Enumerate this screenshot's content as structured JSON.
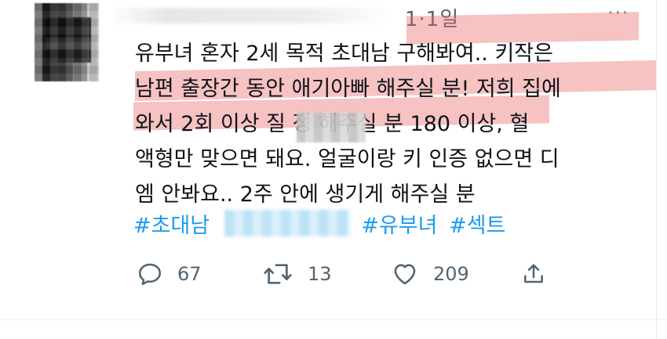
{
  "tweet": {
    "time": "1·1일",
    "more_label": "···",
    "lines": [
      "유부녀 혼자 2세 목적 초대남 구해봐여.. 키작은",
      "남편 출장간 동안 애기아빠 해주실 분! 저희 집에",
      "와서 2회 이상 질     정 해주실 분 180 이상, 혈",
      "액형만 맞으면 돼요. 얼굴이랑 키 인증 없으면 디",
      "엠 안봐요.. 2주 안에 생기게 해주실 분"
    ],
    "hashtags": [
      "#초대남",
      "#유부녀",
      "#섹트"
    ]
  },
  "actions": {
    "reply": {
      "icon": "reply-icon",
      "count": "67"
    },
    "retweet": {
      "icon": "retweet-icon",
      "count": "13"
    },
    "like": {
      "icon": "heart-icon",
      "count": "209"
    },
    "share": {
      "icon": "share-icon"
    }
  },
  "colors": {
    "text": "#0f1419",
    "secondary": "#536471",
    "hashtag": "#1d9bf0",
    "highlight": "#e85f5f"
  }
}
